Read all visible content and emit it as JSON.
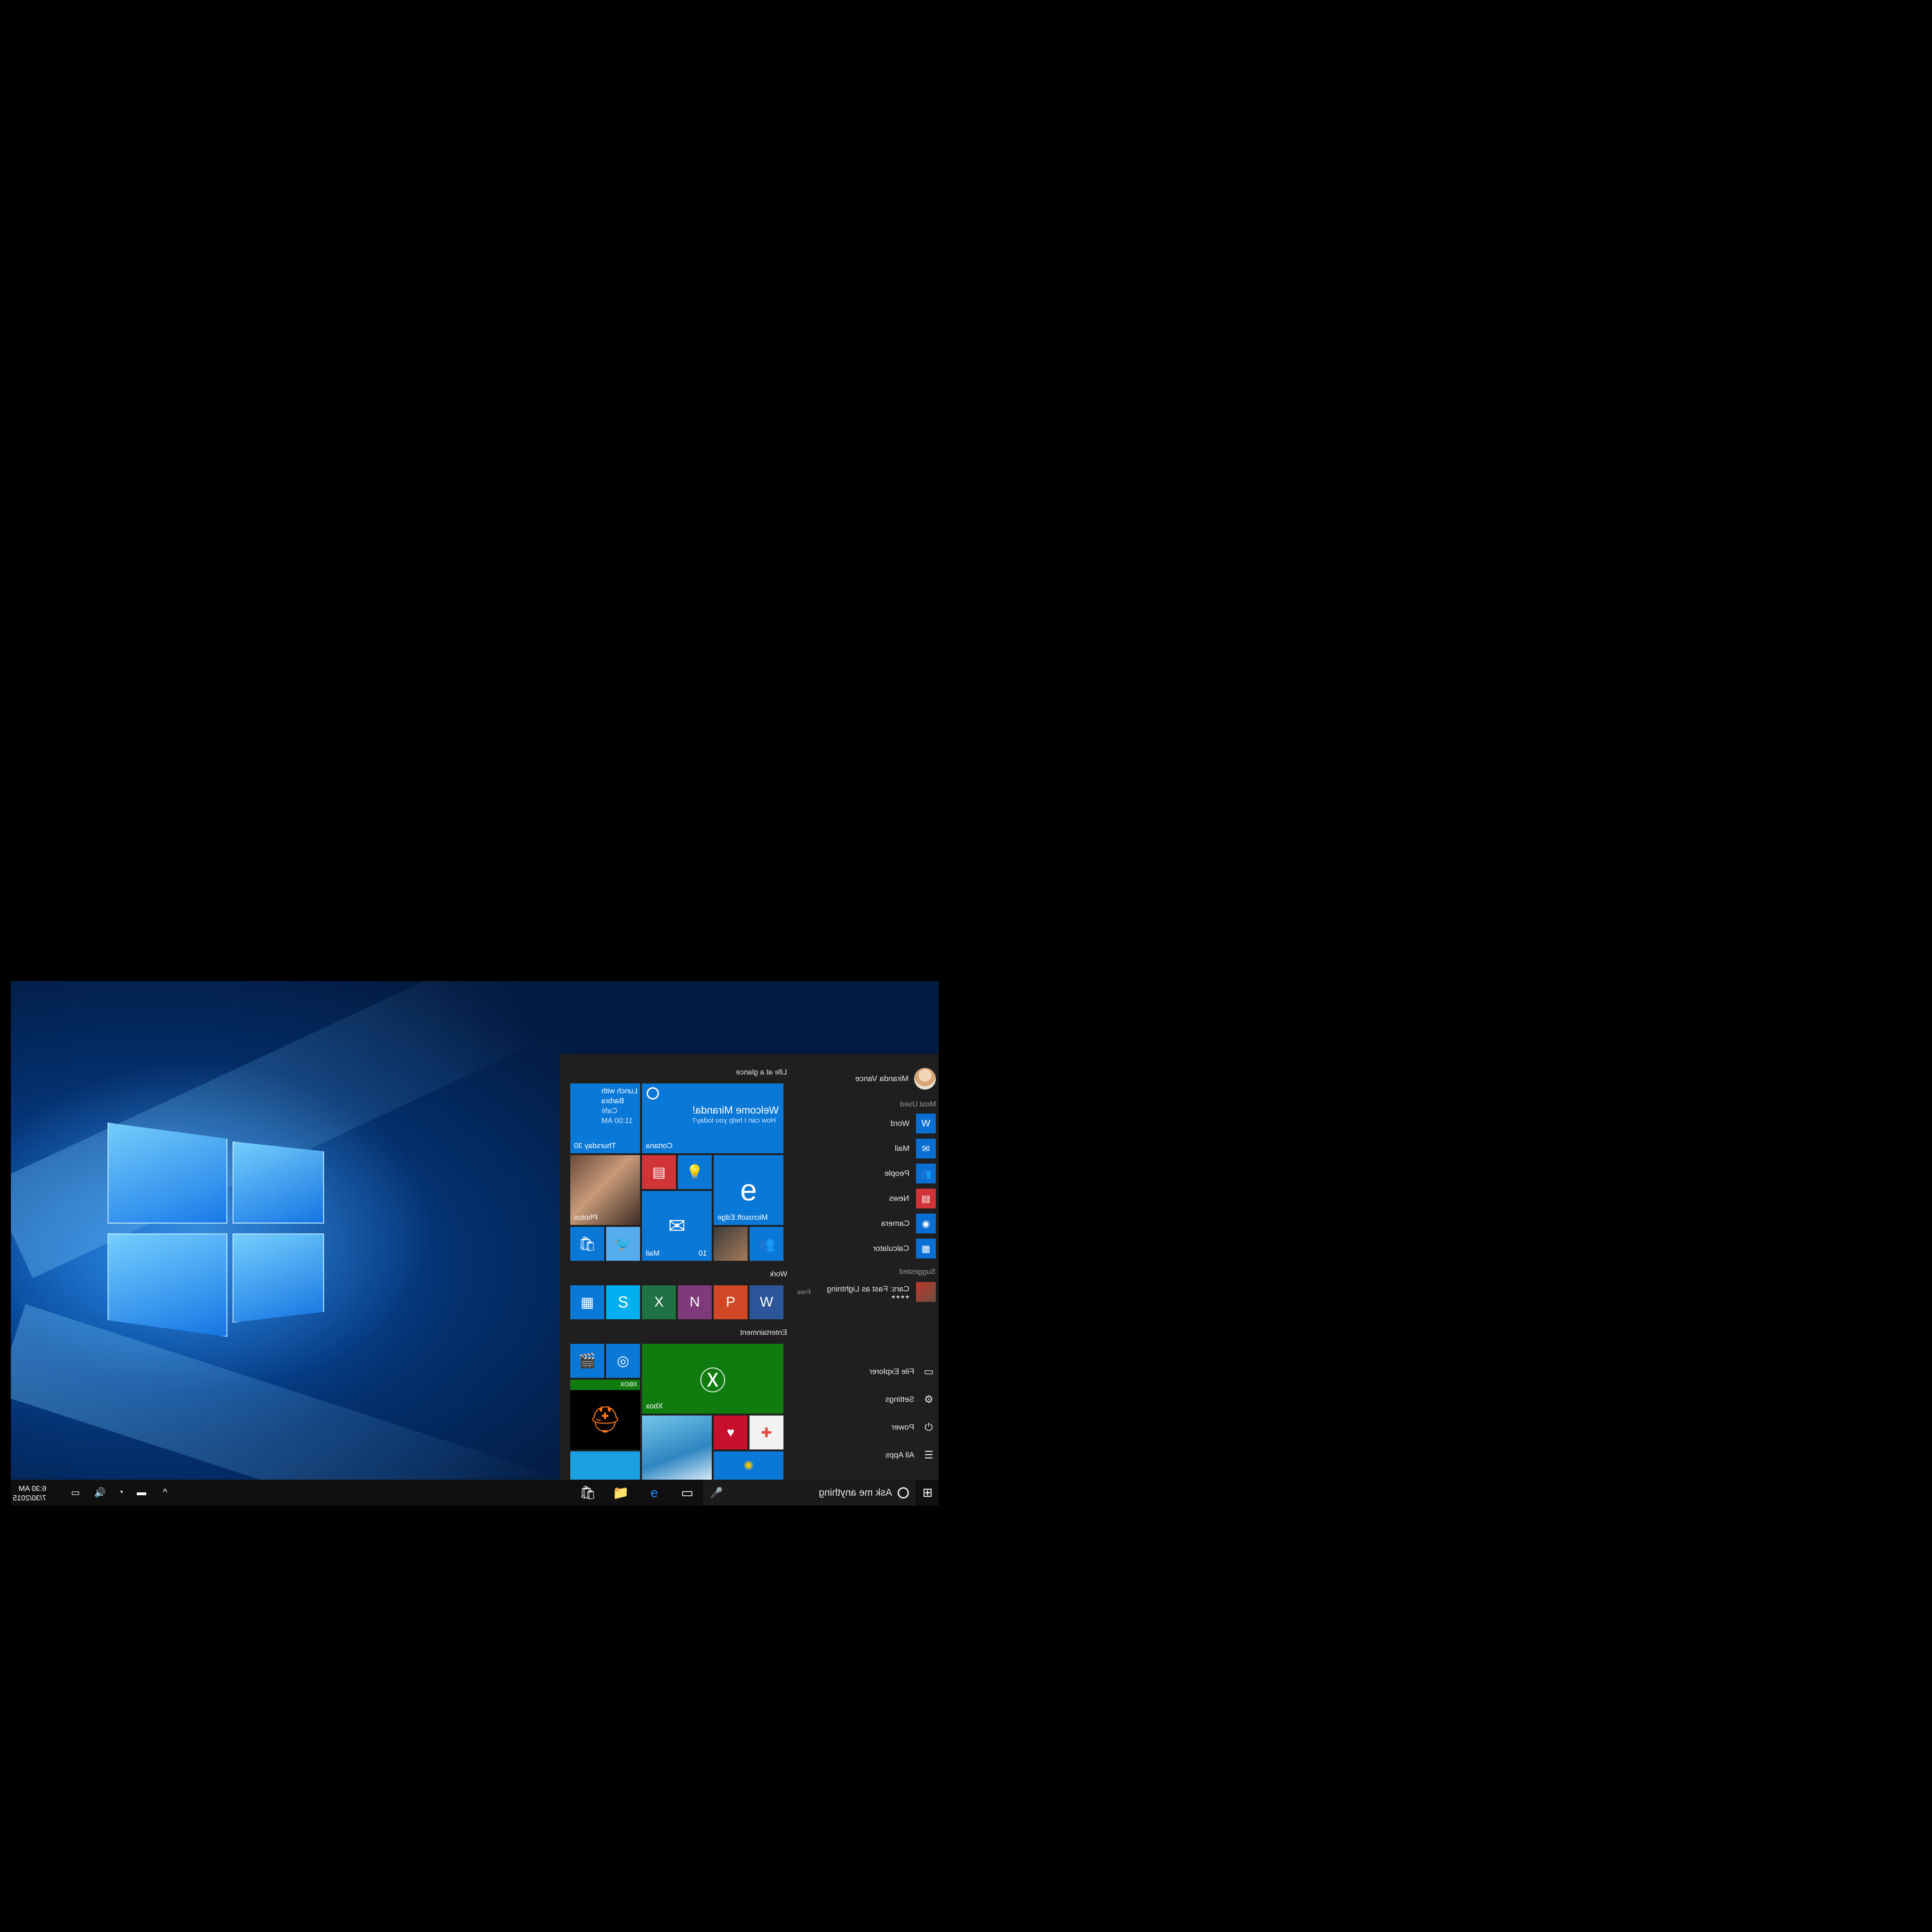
{
  "user": {
    "name": "Miranda Vance"
  },
  "most_used": {
    "label": "Most Used",
    "items": [
      {
        "label": "Word",
        "icon": "word-icon"
      },
      {
        "label": "Mail",
        "icon": "mail-icon"
      },
      {
        "label": "People",
        "icon": "people-icon"
      },
      {
        "label": "News",
        "icon": "news-icon"
      },
      {
        "label": "Camera",
        "icon": "camera-icon"
      },
      {
        "label": "Calculator",
        "icon": "calculator-icon"
      }
    ]
  },
  "suggested": {
    "label": "Suggested",
    "item": {
      "label": "Cars: Fast as Lightning",
      "price": "Free",
      "rating": "★★★★"
    }
  },
  "system": {
    "items": [
      {
        "label": "File Explorer",
        "icon": "folder-icon"
      },
      {
        "label": "Settings",
        "icon": "gear-icon"
      },
      {
        "label": "Power",
        "icon": "power-icon"
      },
      {
        "label": "All Apps",
        "icon": "list-icon"
      }
    ]
  },
  "groups": {
    "life": "Life at a glance",
    "work": "Work",
    "entertainment": "Entertainment"
  },
  "tiles": {
    "calendar": {
      "line1": "Lunch with",
      "line2": "Barbra",
      "line3": "Café",
      "line4": "11:00 AM",
      "day": "Thursday 30"
    },
    "cortana": {
      "title": "Welcome Miranda!",
      "subtitle": "How can I help you today?",
      "label": "Cortana"
    },
    "edge": {
      "label": "Microsoft Edge"
    },
    "photos": {
      "label": "Photos"
    },
    "mail": {
      "label": "Mail",
      "count": "10"
    },
    "xbox": {
      "label": "Xbox"
    },
    "xbox_badge": "XBOX"
  },
  "taskbar": {
    "search_placeholder": "Ask me anything"
  },
  "clock": {
    "time": "6:30 AM",
    "date": "7/30/2015"
  },
  "colors": {
    "accent": "#0a78d7",
    "xbox": "#107c10",
    "red": "#d13438"
  }
}
